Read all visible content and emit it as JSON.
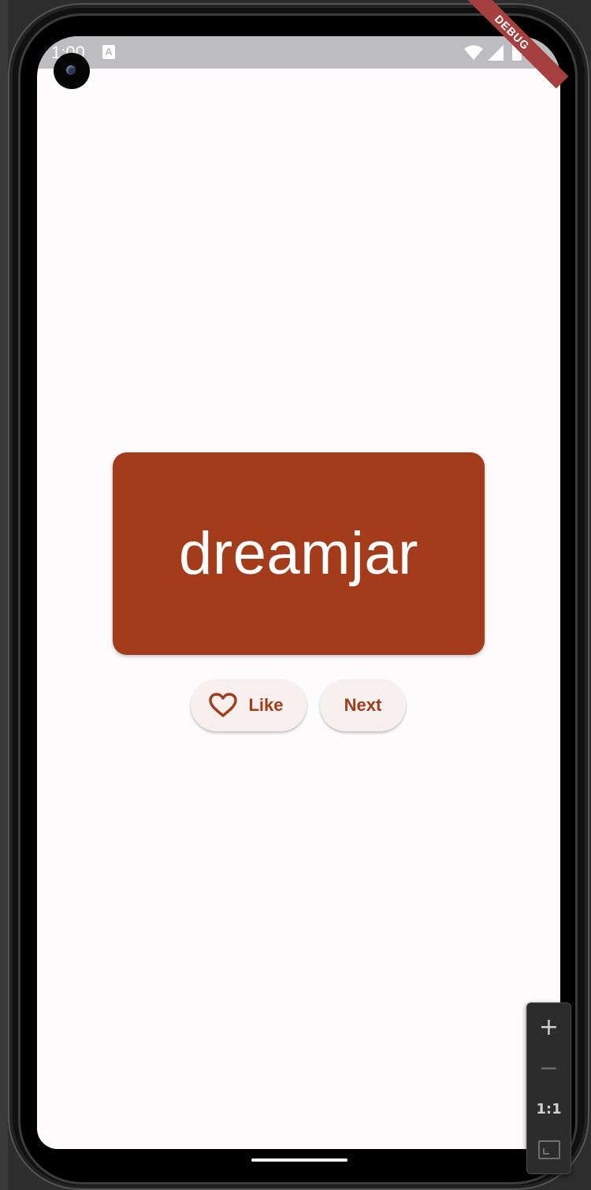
{
  "status_bar": {
    "time": "1:00",
    "notification_badge": "A",
    "icons": [
      "wifi-icon",
      "signal-icon",
      "battery-icon"
    ]
  },
  "debug_banner": "DEBUG",
  "card": {
    "word": "dreamjar",
    "color": "#a43c1b",
    "text_color": "#ffffff"
  },
  "actions": {
    "like_label": "Like",
    "like_icon": "heart-outline-icon",
    "next_label": "Next"
  },
  "emulator_zoom": {
    "zoom_in": "+",
    "zoom_out": "−",
    "reset": "1:1",
    "fit_icon": "fit-screen-icon"
  },
  "colors": {
    "background": "#fefbfd",
    "button_background": "#f8efef",
    "accent": "#a43c1b"
  }
}
